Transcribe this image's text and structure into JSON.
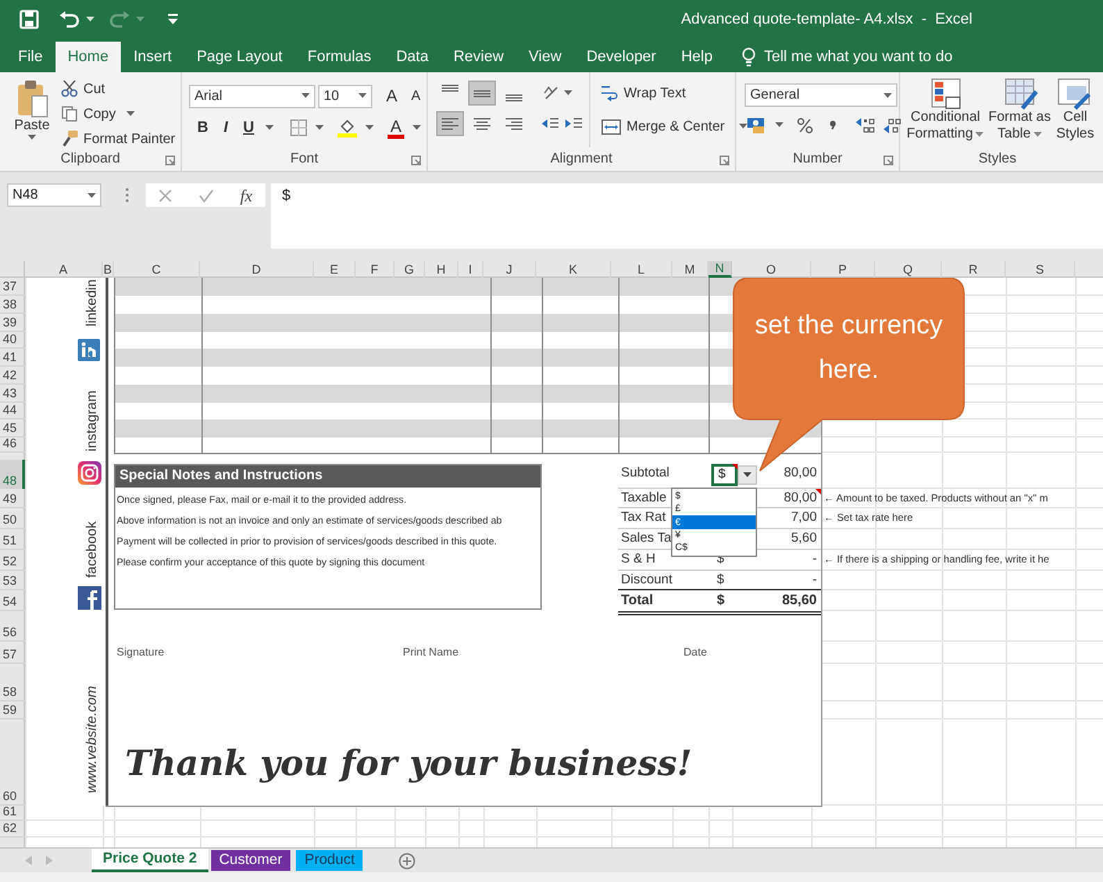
{
  "window": {
    "title": "Advanced quote-template- A4.xlsx  -  Excel"
  },
  "ribbon_tabs": [
    {
      "label": "File",
      "selected": false
    },
    {
      "label": "Home",
      "selected": true
    },
    {
      "label": "Insert",
      "selected": false
    },
    {
      "label": "Page Layout",
      "selected": false
    },
    {
      "label": "Formulas",
      "selected": false
    },
    {
      "label": "Data",
      "selected": false
    },
    {
      "label": "Review",
      "selected": false
    },
    {
      "label": "View",
      "selected": false
    },
    {
      "label": "Developer",
      "selected": false
    },
    {
      "label": "Help",
      "selected": false
    }
  ],
  "tell_me": "Tell me what you want to do",
  "clipboard": {
    "paste": "Paste",
    "cut": "Cut",
    "copy": "Copy",
    "format_painter": "Format Painter",
    "label": "Clipboard"
  },
  "font": {
    "name": "Arial",
    "size": "10",
    "grow": "A",
    "shrink": "A",
    "bold": "B",
    "italic": "I",
    "underline": "U",
    "font_color": "A",
    "label": "Font"
  },
  "alignment": {
    "vertical": [
      {
        "selected": false
      },
      {
        "selected": true
      },
      {
        "selected": false
      }
    ],
    "horizontal": [
      {
        "selected": true
      },
      {
        "selected": false
      },
      {
        "selected": false
      }
    ],
    "wrap_text": "Wrap Text",
    "merge_center": "Merge & Center",
    "label": "Alignment"
  },
  "number": {
    "format": "General",
    "label": "Number"
  },
  "styles": {
    "buttons": [
      {
        "lines": [
          "Conditional",
          "Formatting"
        ]
      },
      {
        "lines": [
          "Format as",
          "Table"
        ]
      },
      {
        "lines": [
          "Cell",
          "Styles"
        ]
      }
    ],
    "label": "Styles"
  },
  "formula_bar": {
    "name_box": "N48",
    "fx": "fx",
    "content": "$"
  },
  "columns": [
    {
      "label": "A",
      "selected": false
    },
    {
      "label": "B",
      "selected": false
    },
    {
      "label": "C",
      "selected": false
    },
    {
      "label": "D",
      "selected": false
    },
    {
      "label": "E",
      "selected": false
    },
    {
      "label": "F",
      "selected": false
    },
    {
      "label": "G",
      "selected": false
    },
    {
      "label": "H",
      "selected": false
    },
    {
      "label": "I",
      "selected": false
    },
    {
      "label": "J",
      "selected": false
    },
    {
      "label": "K",
      "selected": false
    },
    {
      "label": "L",
      "selected": false
    },
    {
      "label": "M",
      "selected": false
    },
    {
      "label": "N",
      "selected": true
    },
    {
      "label": "O",
      "selected": false
    },
    {
      "label": "P",
      "selected": false
    },
    {
      "label": "Q",
      "selected": false
    },
    {
      "label": "R",
      "selected": false
    },
    {
      "label": "S",
      "selected": false
    }
  ],
  "rows": [
    {
      "label": "37",
      "selected": false
    },
    {
      "label": "38",
      "selected": false
    },
    {
      "label": "39",
      "selected": false
    },
    {
      "label": "40",
      "selected": false
    },
    {
      "label": "41",
      "selected": false
    },
    {
      "label": "42",
      "selected": false
    },
    {
      "label": "43",
      "selected": false
    },
    {
      "label": "44",
      "selected": false
    },
    {
      "label": "45",
      "selected": false
    },
    {
      "label": "46",
      "selected": false
    },
    {
      "label": "48",
      "selected": true
    },
    {
      "label": "49",
      "selected": false
    },
    {
      "label": "50",
      "selected": false
    },
    {
      "label": "51",
      "selected": false
    },
    {
      "label": "52",
      "selected": false
    },
    {
      "label": "53",
      "selected": false
    },
    {
      "label": "54",
      "selected": false
    },
    {
      "label": "56",
      "selected": false
    },
    {
      "label": "57",
      "selected": false
    },
    {
      "label": "58",
      "selected": false
    },
    {
      "label": "59",
      "selected": false
    },
    {
      "label": "60",
      "selected": false
    },
    {
      "label": "61",
      "selected": false
    },
    {
      "label": "62",
      "selected": false
    }
  ],
  "side_labels": [
    "linkedin",
    "instagram",
    "facebook",
    "www.vebsite.com"
  ],
  "callout": "set the currency here.",
  "notes": {
    "title": "Special Notes and Instructions",
    "lines": [
      "Once signed, please Fax, mail or e-mail it to the provided address.",
      "Above information is not an invoice and only an estimate of services/goods described ab",
      "Payment will be collected in prior to provision of services/goods described in this quote.",
      "Please confirm your acceptance of this quote by signing this document"
    ]
  },
  "totals": [
    {
      "kind": "active",
      "label": "Subtotal",
      "currency": "$",
      "value": "80,00"
    },
    {
      "kind": "plain",
      "label": "Taxable",
      "value": "80,00"
    },
    {
      "kind": "plain",
      "label": "Tax Rat",
      "value": "7,00"
    },
    {
      "kind": "plain",
      "label": "Sales Ta",
      "value": "5,60"
    },
    {
      "kind": "plain",
      "label": "S & H",
      "currency": "$",
      "value": "-"
    },
    {
      "kind": "plain",
      "label": "Discount",
      "currency": "$",
      "value": "-"
    },
    {
      "kind": "total",
      "label": "Total",
      "currency": "$",
      "value": "85,60"
    }
  ],
  "currency_options": [
    {
      "label": "$",
      "selected": false
    },
    {
      "label": "£",
      "selected": false
    },
    {
      "label": "€",
      "selected": true
    },
    {
      "label": "¥",
      "selected": false
    },
    {
      "label": "C$",
      "selected": false
    }
  ],
  "side_notes": [
    "← Amount to be taxed. Products without an \"x\" m",
    "← Set tax rate here",
    "← If there is a shipping or handling fee, write it he"
  ],
  "signature_labels": [
    "Signature",
    "Print Name",
    "Date"
  ],
  "thank_you": "Thank you for your business!",
  "sheet_tabs": [
    {
      "label": "Price Quote 2",
      "selected": true
    },
    {
      "label": "Customer",
      "selected": false,
      "color": "#7030a0"
    },
    {
      "label": "Product",
      "selected": false,
      "color": "#00b0f0"
    }
  ]
}
